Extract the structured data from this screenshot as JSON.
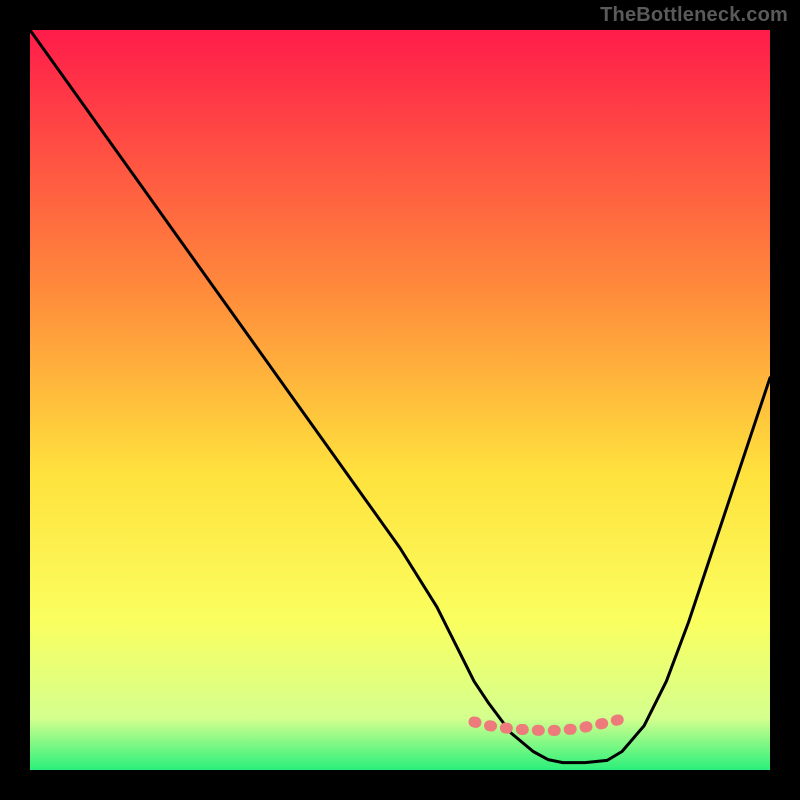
{
  "watermark": "TheBottleneck.com",
  "chart_data": {
    "type": "line",
    "title": "",
    "xlabel": "",
    "ylabel": "",
    "xlim": [
      0,
      100
    ],
    "ylim": [
      0,
      100
    ],
    "series": [
      {
        "name": "bottleneck-curve",
        "x": [
          0,
          5,
          10,
          15,
          20,
          25,
          30,
          35,
          40,
          45,
          50,
          55,
          58,
          60,
          62,
          65,
          68,
          70,
          72,
          75,
          78,
          80,
          83,
          86,
          89,
          92,
          95,
          98,
          100
        ],
        "values": [
          100,
          93,
          86,
          79,
          72,
          65,
          58,
          51,
          44,
          37,
          30,
          22,
          16,
          12,
          9,
          5,
          2.5,
          1.4,
          1.0,
          1.0,
          1.3,
          2.5,
          6,
          12,
          20,
          29,
          38,
          47,
          53
        ]
      },
      {
        "name": "optimal-marker",
        "x": [
          60,
          62,
          64,
          66,
          68,
          70,
          72,
          74,
          76,
          78,
          80
        ],
        "values": [
          6.5,
          6.0,
          5.7,
          5.5,
          5.4,
          5.3,
          5.4,
          5.6,
          6.0,
          6.4,
          6.9
        ]
      }
    ],
    "gradient": {
      "top": "#ff1c4a",
      "upper_mid": "#ff8a3b",
      "mid": "#ffe23d",
      "lower_mid": "#faff60",
      "near_bottom": "#d4ff8e",
      "bottom": "#2af07b"
    },
    "marker_color": "#ed7b7b",
    "curve_color": "#000000"
  }
}
